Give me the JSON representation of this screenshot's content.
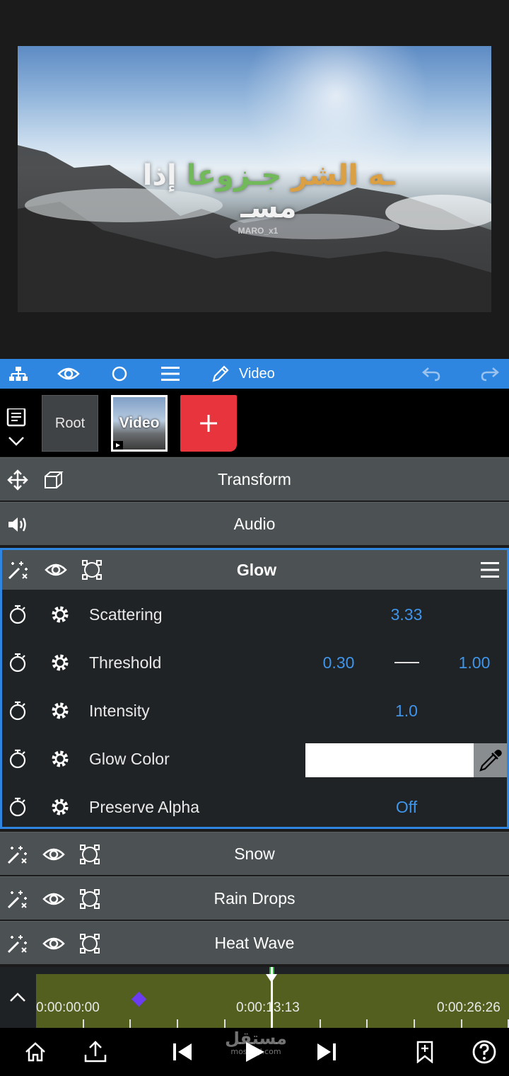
{
  "preview": {
    "caption_words": [
      "إذا مسـ",
      "ـه الشر",
      "جـزوعا"
    ],
    "watermark": "MARO_x1"
  },
  "toolbar": {
    "title": "Video",
    "icons": [
      "layer-tree-icon",
      "eye-icon",
      "circle-icon",
      "menu-icon",
      "pencil-icon",
      "undo-icon",
      "redo-icon"
    ]
  },
  "layers": {
    "root_label": "Root",
    "video_label": "Video"
  },
  "panels": {
    "transform": "Transform",
    "audio": "Audio",
    "glow": "Glow",
    "snow": "Snow",
    "rain_drops": "Rain Drops",
    "heat_wave": "Heat Wave"
  },
  "glow_params": {
    "scattering": {
      "label": "Scattering",
      "value": "3.33"
    },
    "threshold": {
      "label": "Threshold",
      "min": "0.30",
      "max": "1.00"
    },
    "intensity": {
      "label": "Intensity",
      "value": "1.0"
    },
    "glow_color": {
      "label": "Glow Color",
      "color": "#ffffff"
    },
    "preserve_alpha": {
      "label": "Preserve Alpha",
      "value": "Off"
    }
  },
  "timeline": {
    "start": "0:00:00:00",
    "current": "0:00:13:13",
    "end": "0:00:26:26"
  },
  "brand": {
    "ar": "مستقل",
    "url": "mostaql.com"
  },
  "colors": {
    "accent": "#2f86e0",
    "value": "#3f95ea",
    "add_button": "#e8353d",
    "track": "#525f1e",
    "keyframe": "#6b3cf0"
  }
}
